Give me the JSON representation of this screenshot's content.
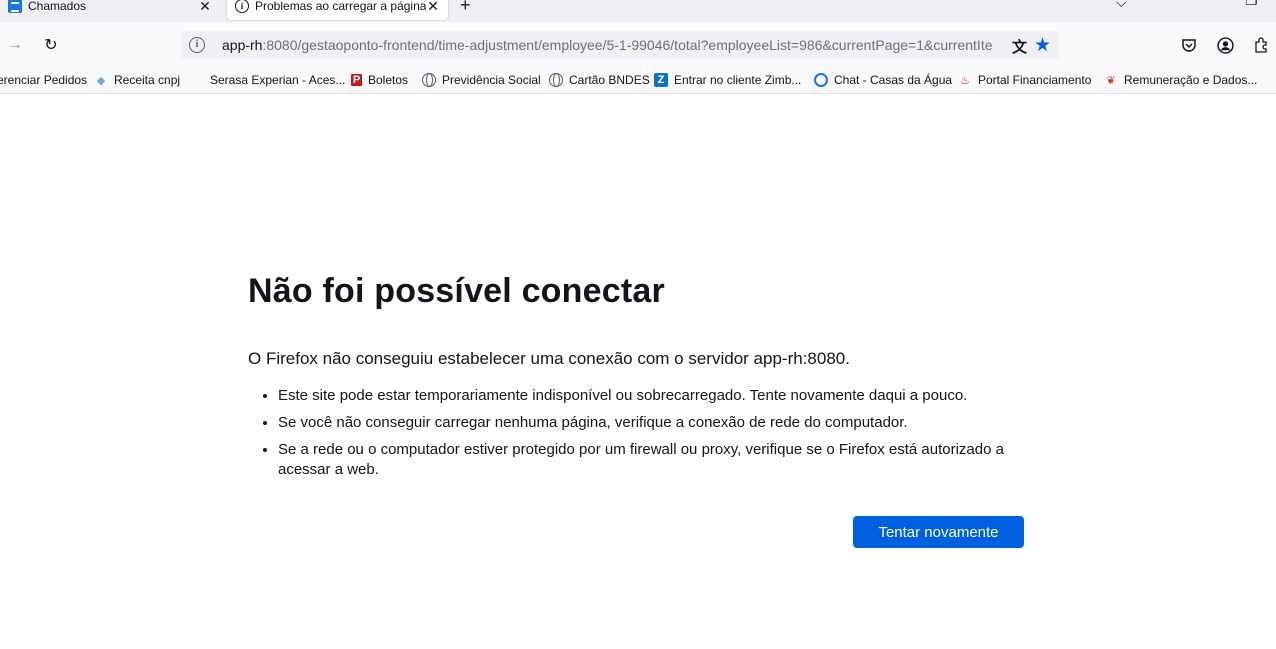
{
  "tabs": [
    {
      "title": "Chamados",
      "icon": "document-icon"
    },
    {
      "title": "Problemas ao carregar a página",
      "icon": "info-icon",
      "active": true
    }
  ],
  "navbar": {
    "url_host": "app-rh",
    "url_rest": ":8080/gestaoponto-frontend/time-adjustment/employee/5-1-99046/total?employeeList=986&currentPage=1&currentIte"
  },
  "bookmarks": [
    {
      "label": "erenciar Pedidos",
      "icon": "none"
    },
    {
      "label": "Receita cnpj",
      "icon": "gem-icon"
    },
    {
      "label": "Serasa Experian - Aces...",
      "icon": "blank-icon"
    },
    {
      "label": "Boletos",
      "icon": "pdf-icon"
    },
    {
      "label": "Previdência Social",
      "icon": "globe-icon"
    },
    {
      "label": "Cartão BNDES",
      "icon": "globe-icon"
    },
    {
      "label": "Entrar no cliente Zimb...",
      "icon": "zimbra-icon"
    },
    {
      "label": "Chat - Casas da Água",
      "icon": "chat-icon"
    },
    {
      "label": "Portal Financiamento",
      "icon": "santander-icon"
    },
    {
      "label": "Remuneração e Dados...",
      "icon": "feather-icon"
    }
  ],
  "error": {
    "title": "Não foi possível conectar",
    "lead": "O Firefox não conseguiu estabelecer uma conexão com o servidor app-rh:8080.",
    "items": [
      "Este site pode estar temporariamente indisponível ou sobrecarregado. Tente novamente daqui a pouco.",
      "Se você não conseguir carregar nenhuma página, verifique a conexão de rede do computador.",
      "Se a rede ou o computador estiver protegido por um firewall ou proxy, verifique se o Firefox está autorizado a acessar a web."
    ],
    "button": "Tentar novamente"
  },
  "colors": {
    "accent": "#0061e0",
    "tabstrip": "#f0f0f4",
    "toolbar": "#f9f9fb"
  }
}
